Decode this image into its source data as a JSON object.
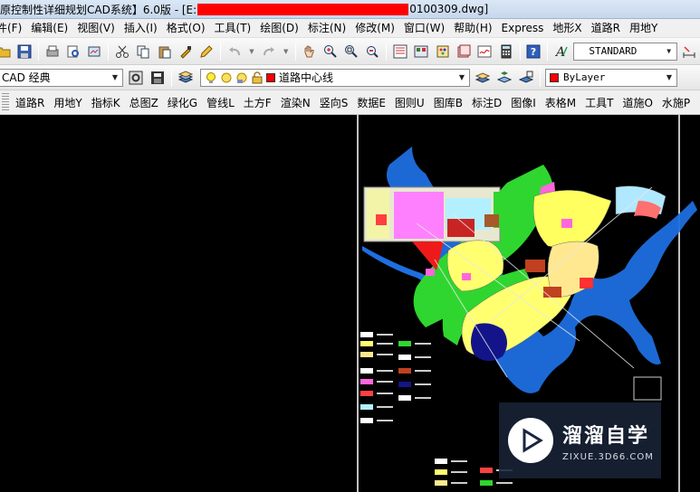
{
  "window": {
    "title_prefix": "原控制性详细规划CAD系统】6.0版 - [E:",
    "title_suffix": "0100309.dwg]"
  },
  "menubar": {
    "items": [
      "件(F)",
      "编辑(E)",
      "视图(V)",
      "插入(I)",
      "格式(O)",
      "工具(T)",
      "绘图(D)",
      "标注(N)",
      "修改(M)",
      "窗口(W)",
      "帮助(H)",
      "Express",
      "地形X",
      "道路R",
      "用地Y"
    ]
  },
  "toolbar": {
    "text_style": "STANDARD",
    "workspace": "CAD 经典",
    "layer": "道路中心线",
    "layer_color": "#ff0000",
    "color_control": "ByLayer",
    "bylayer_color": "#ff0000"
  },
  "plugin_menu": {
    "items": [
      "道路R",
      "用地Y",
      "指标K",
      "总图Z",
      "绿化G",
      "管线L",
      "土方F",
      "渲染N",
      "竖向S",
      "数据E",
      "图则U",
      "图库B",
      "标注D",
      "图像I",
      "表格M",
      "工具T",
      "道施O",
      "水施P"
    ]
  },
  "watermark": {
    "brand": "溜溜自学",
    "url": "ZIXUE.3D66.COM"
  }
}
